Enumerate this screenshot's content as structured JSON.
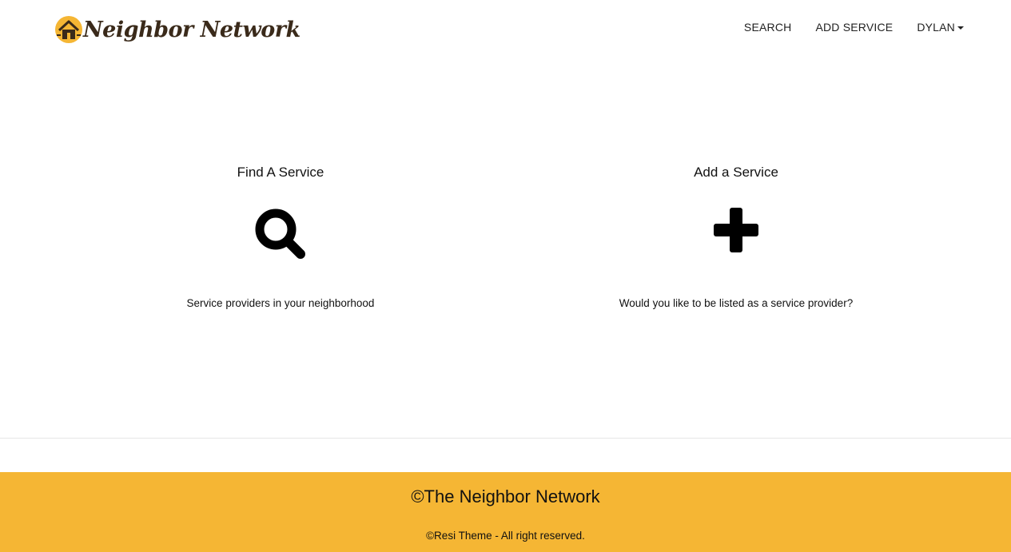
{
  "brand": {
    "name": "Neighbor Network",
    "logo_icon": "house-icon"
  },
  "nav": {
    "items": [
      {
        "label": "SEARCH"
      },
      {
        "label": "ADD SERVICE"
      },
      {
        "label": "DYLAN",
        "icon": "caret-down-icon"
      }
    ]
  },
  "features": [
    {
      "title": "Find A Service",
      "icon": "search-icon",
      "description": "Service providers in your neighborhood"
    },
    {
      "title": "Add a Service",
      "icon": "plus-icon",
      "description": "Would you like to be listed as a service provider?"
    }
  ],
  "footer": {
    "title": "©The Neighbor Network",
    "copyright": "©Resi Theme - All right reserved.",
    "background": "#f5b634"
  },
  "colors": {
    "accent": "#f5b634",
    "brand_text": "#3a2a1a"
  }
}
